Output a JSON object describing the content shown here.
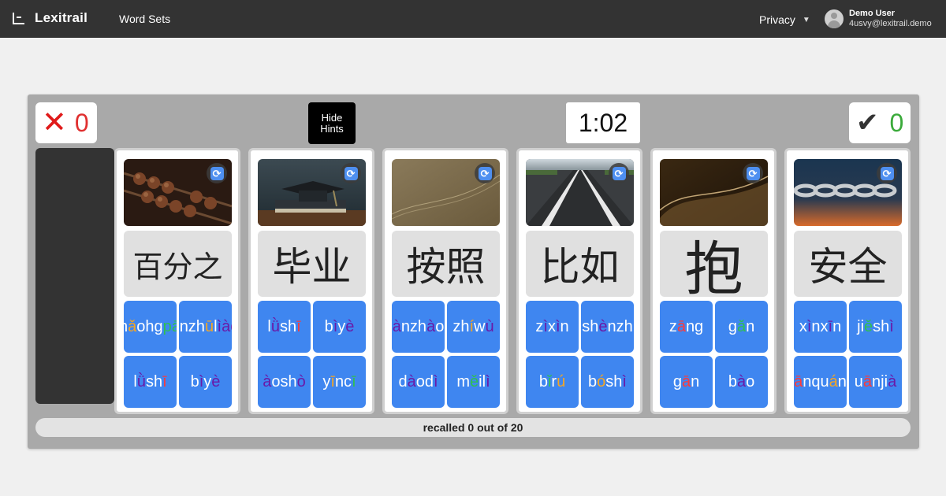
{
  "header": {
    "app_title": "Lexitrail",
    "nav_link": "Word Sets",
    "privacy_label": "Privacy",
    "user_name": "Demo User",
    "user_email": "4usvy@lexitrail.demo"
  },
  "game": {
    "wrong_count": "0",
    "right_count": "0",
    "hints_button": [
      "Hide",
      "Hints"
    ],
    "timer": "1:02",
    "progress_text": "recalled 0 out of 20"
  },
  "cards": [
    {
      "image": "abacus",
      "word": "百分之",
      "options": [
        [
          {
            "t": "ā",
            "c": "t1"
          },
          {
            "t": "zh"
          },
          {
            "t": "ǎ",
            "c": "t2"
          },
          {
            "t": "oh"
          },
          {
            "t": "g"
          },
          {
            "t": "pā",
            "c": "t1"
          },
          {
            "t": "ng"
          }
        ],
        [
          {
            "t": "ā",
            "c": "t1"
          },
          {
            "t": "if"
          },
          {
            "t": "ē",
            "c": "t4"
          },
          {
            "t": "nzh"
          },
          {
            "t": "ū",
            "c": "t2"
          },
          {
            "t": "l"
          },
          {
            "t": "ì",
            "c": "t3"
          },
          {
            "t": "ào",
            "c": "t3"
          },
          {
            "t": "d"
          },
          {
            "t": "à",
            "c": "t3"
          }
        ],
        [
          {
            "t": "l"
          },
          {
            "t": "ǜ",
            "c": "t3"
          },
          {
            "t": "sh"
          },
          {
            "t": "ī",
            "c": "t4"
          }
        ],
        [
          {
            "t": "b"
          },
          {
            "t": "ì",
            "c": "t3"
          },
          {
            "t": "y"
          },
          {
            "t": "è",
            "c": "t3"
          }
        ]
      ]
    },
    {
      "image": "graduation",
      "word": "毕业",
      "options": [
        [
          {
            "t": "l"
          },
          {
            "t": "ǜ",
            "c": "t3"
          },
          {
            "t": "sh"
          },
          {
            "t": "ī",
            "c": "t4"
          }
        ],
        [
          {
            "t": "b"
          },
          {
            "t": "ì",
            "c": "t3"
          },
          {
            "t": "y"
          },
          {
            "t": "è",
            "c": "t3"
          }
        ],
        [
          {
            "t": "à",
            "c": "t3"
          },
          {
            "t": "osh"
          },
          {
            "t": "ò",
            "c": "t3"
          }
        ],
        [
          {
            "t": "y"
          },
          {
            "t": "ī",
            "c": "t2"
          },
          {
            "t": "nc"
          },
          {
            "t": "ī",
            "c": "t1"
          }
        ]
      ]
    },
    {
      "image": "wave",
      "word": "按照",
      "options": [
        [
          {
            "t": "à",
            "c": "t3"
          },
          {
            "t": "nzh"
          },
          {
            "t": "à",
            "c": "t3"
          },
          {
            "t": "o"
          }
        ],
        [
          {
            "t": "zh"
          },
          {
            "t": "í",
            "c": "t2"
          },
          {
            "t": "w"
          },
          {
            "t": "ù",
            "c": "t3"
          }
        ],
        [
          {
            "t": "d"
          },
          {
            "t": "à",
            "c": "t3"
          },
          {
            "t": "od"
          },
          {
            "t": "ì",
            "c": "t3"
          }
        ],
        [
          {
            "t": "m"
          },
          {
            "t": "ě",
            "c": "t1"
          },
          {
            "t": "il"
          },
          {
            "t": "ì",
            "c": "t3"
          }
        ]
      ]
    },
    {
      "image": "road",
      "word": "比如",
      "options": [
        [
          {
            "t": "z"
          },
          {
            "t": "ì",
            "c": "t3"
          },
          {
            "t": "x"
          },
          {
            "t": "ì",
            "c": "t3"
          },
          {
            "t": "n"
          }
        ],
        [
          {
            "t": "sh"
          },
          {
            "t": "è",
            "c": "t3"
          },
          {
            "t": "nzh"
          }
        ],
        [
          {
            "t": "b"
          },
          {
            "t": "ǐ",
            "c": "t1"
          },
          {
            "t": "r"
          },
          {
            "t": "ú",
            "c": "t2"
          }
        ],
        [
          {
            "t": "b"
          },
          {
            "t": "ó",
            "c": "t2"
          },
          {
            "t": "sh"
          },
          {
            "t": "ì",
            "c": "t3"
          }
        ]
      ]
    },
    {
      "image": "wave2",
      "word": "抱",
      "options": [
        [
          {
            "t": "z"
          },
          {
            "t": "ā",
            "c": "t4"
          },
          {
            "t": "ng"
          }
        ],
        [
          {
            "t": "g"
          },
          {
            "t": "ǎ",
            "c": "t1"
          },
          {
            "t": "n"
          }
        ],
        [
          {
            "t": "g"
          },
          {
            "t": "ā",
            "c": "t4"
          },
          {
            "t": "n"
          }
        ],
        [
          {
            "t": "b"
          },
          {
            "t": "à",
            "c": "t3"
          },
          {
            "t": "o"
          }
        ]
      ]
    },
    {
      "image": "chain",
      "word": "安全",
      "options": [
        [
          {
            "t": "x"
          },
          {
            "t": "ì",
            "c": "t3"
          },
          {
            "t": "nx"
          },
          {
            "t": "ī",
            "c": "t3"
          },
          {
            "t": "n"
          }
        ],
        [
          {
            "t": "ji"
          },
          {
            "t": "ě",
            "c": "t1"
          },
          {
            "t": "sh"
          },
          {
            "t": "ì",
            "c": "t3"
          }
        ],
        [
          {
            "t": "ā",
            "c": "t4"
          },
          {
            "t": "nqu"
          },
          {
            "t": "á",
            "c": "t2"
          },
          {
            "t": "n"
          }
        ],
        [
          {
            "t": "u"
          },
          {
            "t": "ā",
            "c": "t4"
          },
          {
            "t": "nji"
          },
          {
            "t": "à",
            "c": "t3"
          }
        ]
      ]
    }
  ],
  "colors": {
    "navbar": "#333333",
    "option_button": "#3f86f0",
    "tone1": "#2fc052",
    "tone2": "#f5a623",
    "tone3": "#6a1aa8",
    "tone4": "#ff3a3a"
  },
  "icons": [
    "lexitrail-logo-icon",
    "close-x-icon",
    "checkmark-icon",
    "refresh-icon",
    "avatar-icon",
    "caret-down-icon"
  ]
}
